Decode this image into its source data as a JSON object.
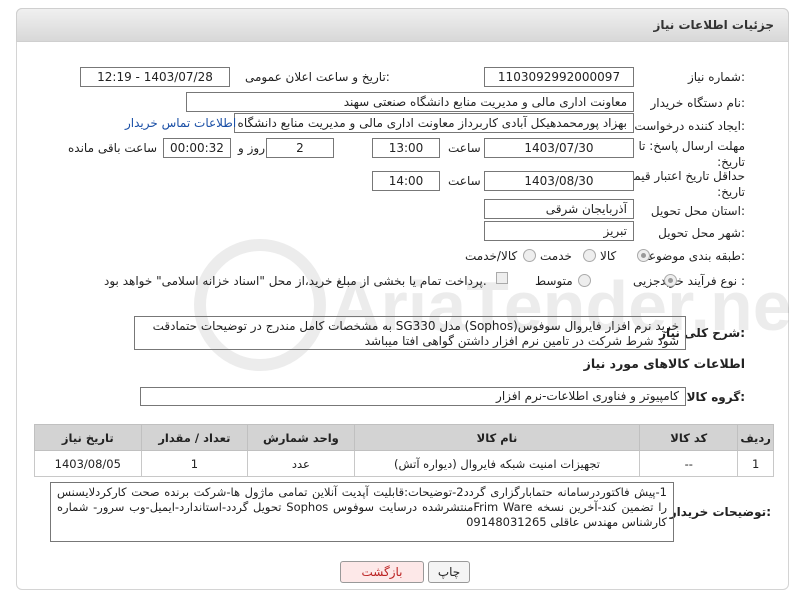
{
  "header": {
    "title": "جزئیات اطلاعات نیاز"
  },
  "fields": {
    "need_number_label": "شماره نیاز:",
    "need_number": "1103092992000097",
    "announce_label": "تاریخ و ساعت اعلان عمومی:",
    "announce_value": "1403/07/28 - 12:19",
    "buyer_org_label": "نام دستگاه خریدار:",
    "buyer_org": "معاونت اداری  مالی و مدیریت منابع دانشگاه صنعتی سهند",
    "requester_label": "ایجاد کننده درخواست:",
    "requester": "بهزاد پورمحمدهیکل آبادی کاربرداز معاونت اداری  مالی و مدیریت منابع دانشگاه صنعتی سهند",
    "contact_link": "اطلاعات تماس خریدار",
    "deadline_label": "مهلت ارسال پاسخ: تا تاریخ:",
    "deadline_date": "1403/07/30",
    "time_label": "ساعت",
    "deadline_time": "13:00",
    "days_value": "2",
    "days_label": "روز و",
    "remaining_value": "00:00:32",
    "remaining_label": "ساعت باقی مانده",
    "price_valid_label": "حداقل تاریخ اعتبار قیمت: تا تاریخ:",
    "price_valid_date": "1403/08/30",
    "price_valid_time": "14:00",
    "province_label": "استان محل تحویل:",
    "province": "آذربایجان شرقی",
    "city_label": "شهر محل تحویل:",
    "city": "تبریز",
    "category_label": "طبقه بندی موضوعی:",
    "category_options": [
      "کالا",
      "خدمت",
      "کالا/خدمت"
    ],
    "process_label": "نوع فرآیند خرید :",
    "process_options": [
      "جزیی",
      "متوسط"
    ],
    "payment_note": "پرداخت تمام یا بخشی از مبلغ خرید،از محل \"اسناد خزانه اسلامی\" خواهد بود."
  },
  "description": {
    "label": "شرح کلی نیاز:",
    "text": "خرید نرم افزار فایروال سوفوس(Sophos) مدل SG330 به مشخصات کامل مندرج در توضیحات حتمادقت شود شرط شرکت در تامین نرم افزار داشتن گواهی افتا میباشد"
  },
  "goods_info": {
    "title": "اطلاعات کالاهای مورد نیاز",
    "group_label": "گروه کالا:",
    "group_value": "کامپیوتر و فناوری اطلاعات-نرم افزار"
  },
  "table": {
    "headers": [
      "ردیف",
      "کد کالا",
      "نام کالا",
      "واحد شمارش",
      "تعداد / مقدار",
      "تاریخ نیاز"
    ],
    "rows": [
      [
        "1",
        "--",
        "تجهیزات امنیت شبکه فایروال (دیواره آتش)",
        "عدد",
        "1",
        "1403/08/05"
      ]
    ]
  },
  "buyer_notes": {
    "label": "توضیحات خریدار:",
    "text": "1-پیش فاکتوردرسامانه حتمابارگزاری گردد2-توضیحات:قابلیت آپدیت آنلاین تمامی ماژول ها-شرکت برنده صحت کارکردلایسنس را تضمین کند-آخرین نسخه Frim Wareمنتشرشده درسایت سوفوس Sophos تحویل گردد-استاندارد-ایمیل-وب سرور- شماره کارشناس مهندس عاقلی 09148031265"
  },
  "buttons": {
    "print": "چاپ",
    "back": "بازگشت"
  },
  "watermark": {
    "text": "AriaTender.net"
  }
}
